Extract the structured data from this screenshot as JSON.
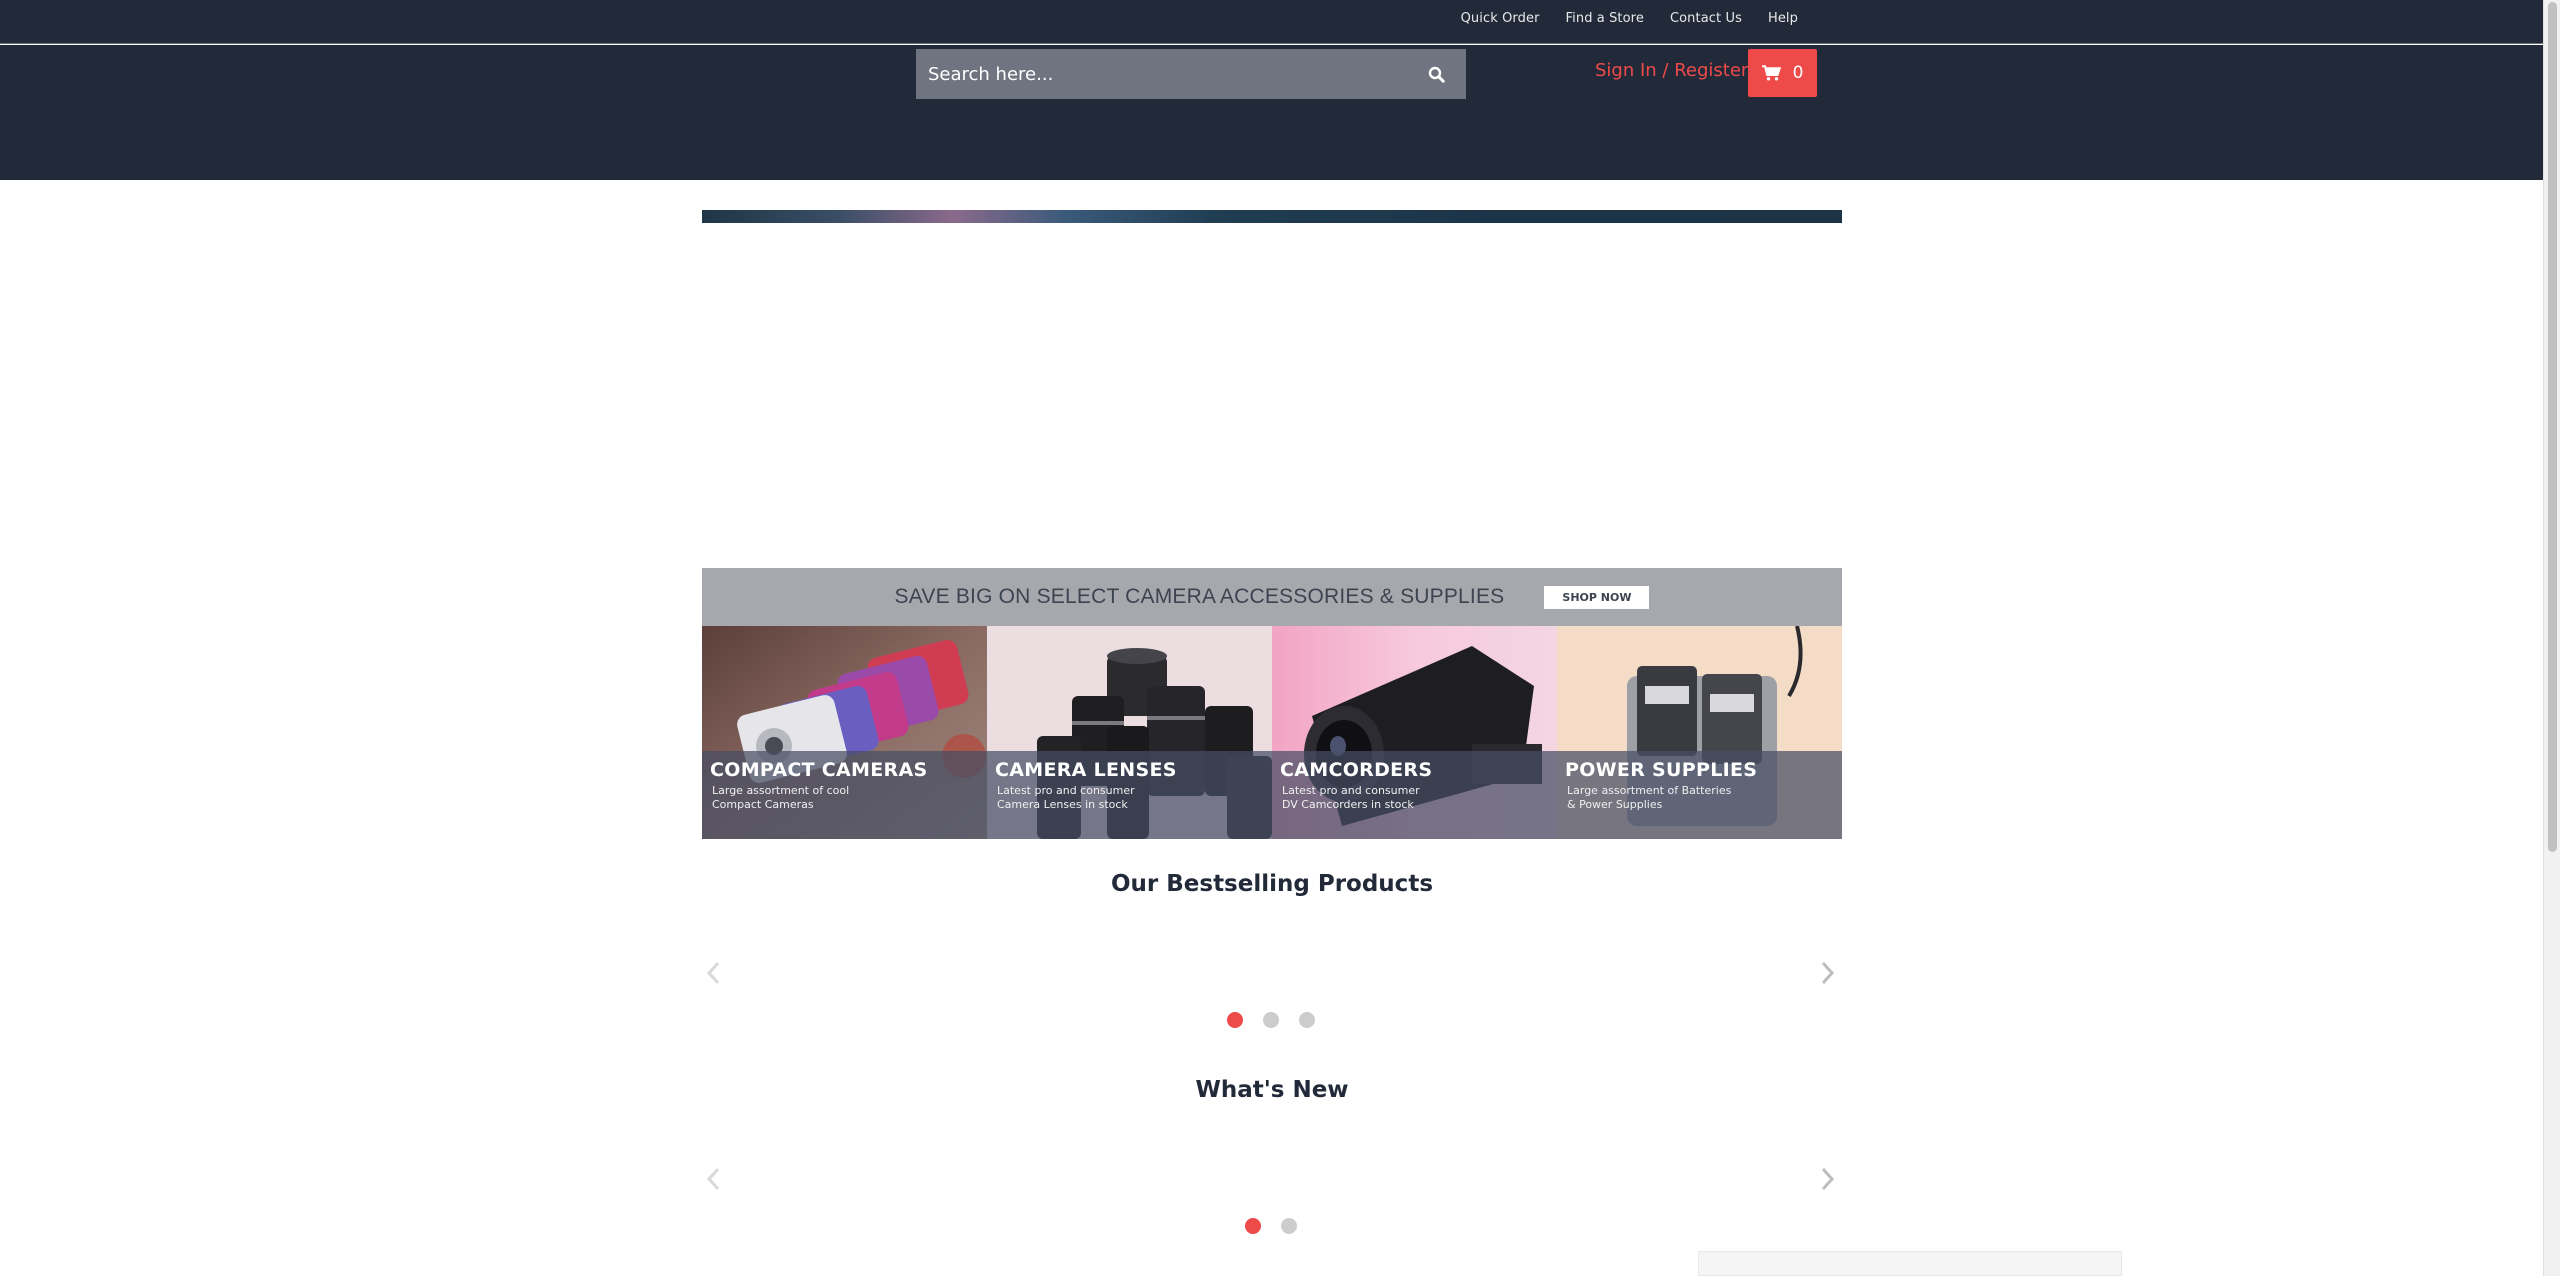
{
  "header": {
    "top_links": [
      "Quick Order",
      "Find a Store",
      "Contact Us",
      "Help"
    ],
    "search_placeholder": "Search here...",
    "signin_label": "Sign In / Register",
    "cart_count": "0"
  },
  "promo": {
    "text": "SAVE BIG ON SELECT CAMERA ACCESSORIES & SUPPLIES",
    "button": "SHOP NOW"
  },
  "categories": [
    {
      "title": "COMPACT CAMERAS",
      "line1": "Large assortment of cool",
      "line2": "Compact Cameras"
    },
    {
      "title": "CAMERA LENSES",
      "line1": "Latest pro and consumer",
      "line2": "Camera Lenses in stock"
    },
    {
      "title": "CAMCORDERS",
      "line1": "Latest pro and consumer",
      "line2": "DV Camcorders in stock"
    },
    {
      "title": "POWER SUPPLIES",
      "line1": "Large assortment of Batteries",
      "line2": "& Power Supplies"
    }
  ],
  "bestselling": {
    "title": "Our Bestselling Products",
    "active_page": 1,
    "page_count": 3
  },
  "whats_new": {
    "title": "What's New",
    "active_page": 1,
    "page_count": 2
  },
  "colors": {
    "header_bg": "#222a3a",
    "accent": "#ef4a4a",
    "promo_bg": "#a6a8ad"
  }
}
